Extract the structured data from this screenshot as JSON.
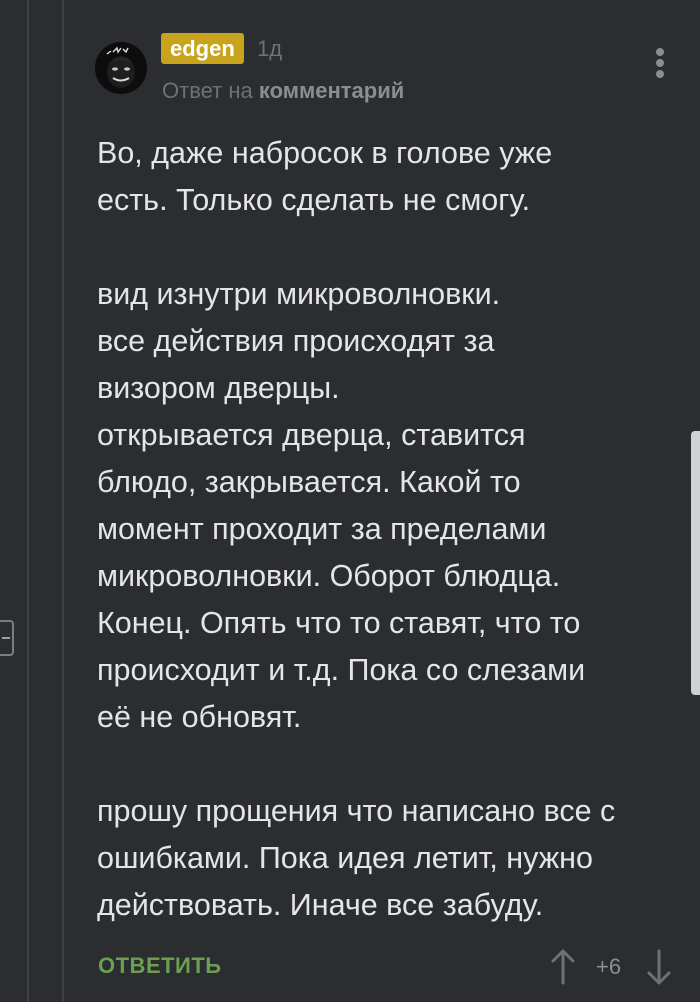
{
  "comment": {
    "author": "edgen",
    "time": "1д",
    "reply_prefix": "Ответ на",
    "reply_target": "комментарий",
    "paragraphs": [
      [
        "Во, даже набросок в голове уже",
        "есть. Только сделать не смогу."
      ],
      [
        "вид изнутри микроволновки.",
        "все действия происходят за",
        "визором дверцы.",
        "открывается дверца, ставится",
        "блюдо, закрывается. Какой то",
        "момент проходит за пределами",
        "микроволновки. Оборот блюдца.",
        "Конец. Опять что то ставят, что то",
        "происходит и т.д. Пока со слезами",
        "её не обновят."
      ],
      [
        "прошу прощения что написано все с",
        "ошибками. Пока идея летит, нужно",
        "действовать. Иначе все забуду."
      ]
    ],
    "rating": "+6"
  },
  "actions": {
    "reply_label": "ОТВЕТИТЬ"
  },
  "icons": {
    "vote_up": "arrow-up-icon",
    "vote_down": "arrow-down-icon",
    "menu": "more-vertical-icon",
    "collapse": "collapse-thread-icon"
  },
  "colors": {
    "background": "#2b2d31",
    "text": "#e4e5e7",
    "muted": "#6e7176",
    "username_badge": "#c8a41e",
    "reply_action": "#6aa04f"
  }
}
